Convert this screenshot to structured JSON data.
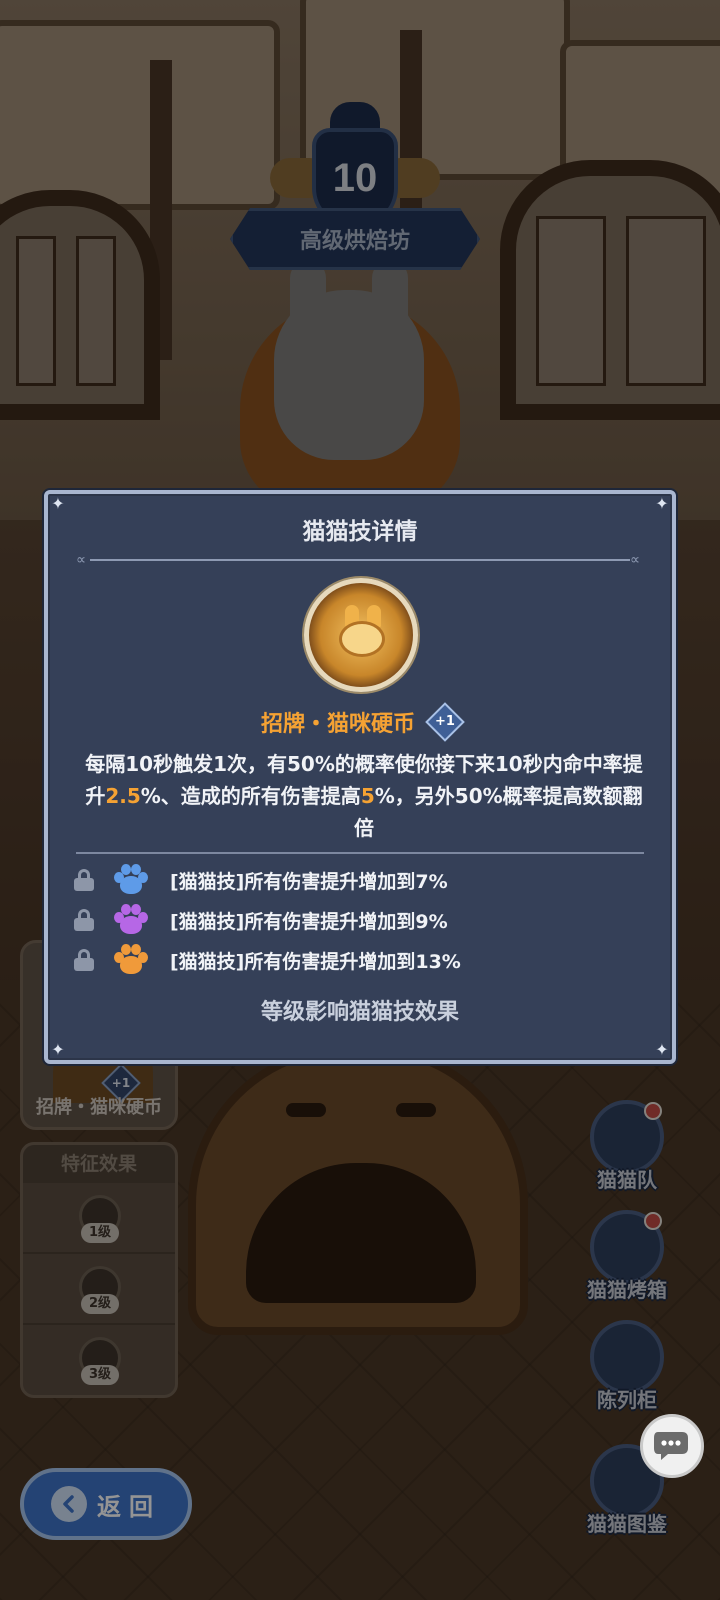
{
  "level_badge": {
    "level": "10",
    "name": "高级烘焙坊"
  },
  "modal": {
    "title": "猫猫技详情",
    "skill_name": "招牌・猫咪硬币",
    "skill_plus": "+1",
    "description": {
      "part1": "每隔10秒触发1次，有50%的概率使你接下来10秒内命中率提升",
      "hl1": "2.5",
      "part2": "%、造成的所有伤害提高",
      "hl2": "5",
      "part3": "%，另外50%概率提高数额翻倍"
    },
    "bonuses": [
      {
        "paw_color": "#5e9be8",
        "text": "[猫猫技]所有伤害提升增加到7%"
      },
      {
        "paw_color": "#b667e6",
        "text": "[猫猫技]所有伤害提升增加到9%"
      },
      {
        "paw_color": "#f09a3a",
        "text": "[猫猫技]所有伤害提升增加到13%"
      }
    ],
    "footer": "等级影响猫猫技效果"
  },
  "left_panel": {
    "skill_label": "招牌・猫咪硬币",
    "skill_plus": "+1",
    "trait_title": "特征效果",
    "traits": [
      {
        "level": "1级"
      },
      {
        "level": "2级"
      },
      {
        "level": "3级"
      }
    ]
  },
  "right_menu": [
    {
      "label": "猫猫队",
      "has_dot": true
    },
    {
      "label": "猫猫烤箱",
      "has_dot": true
    },
    {
      "label": "陈列柜",
      "has_dot": false
    },
    {
      "label": "猫猫图鉴",
      "has_dot": false
    }
  ],
  "back_button": {
    "label": "返回"
  },
  "colors": {
    "accent": "#f5a233",
    "modal_bg": "#354058",
    "modal_border": "#a9b6cf"
  }
}
